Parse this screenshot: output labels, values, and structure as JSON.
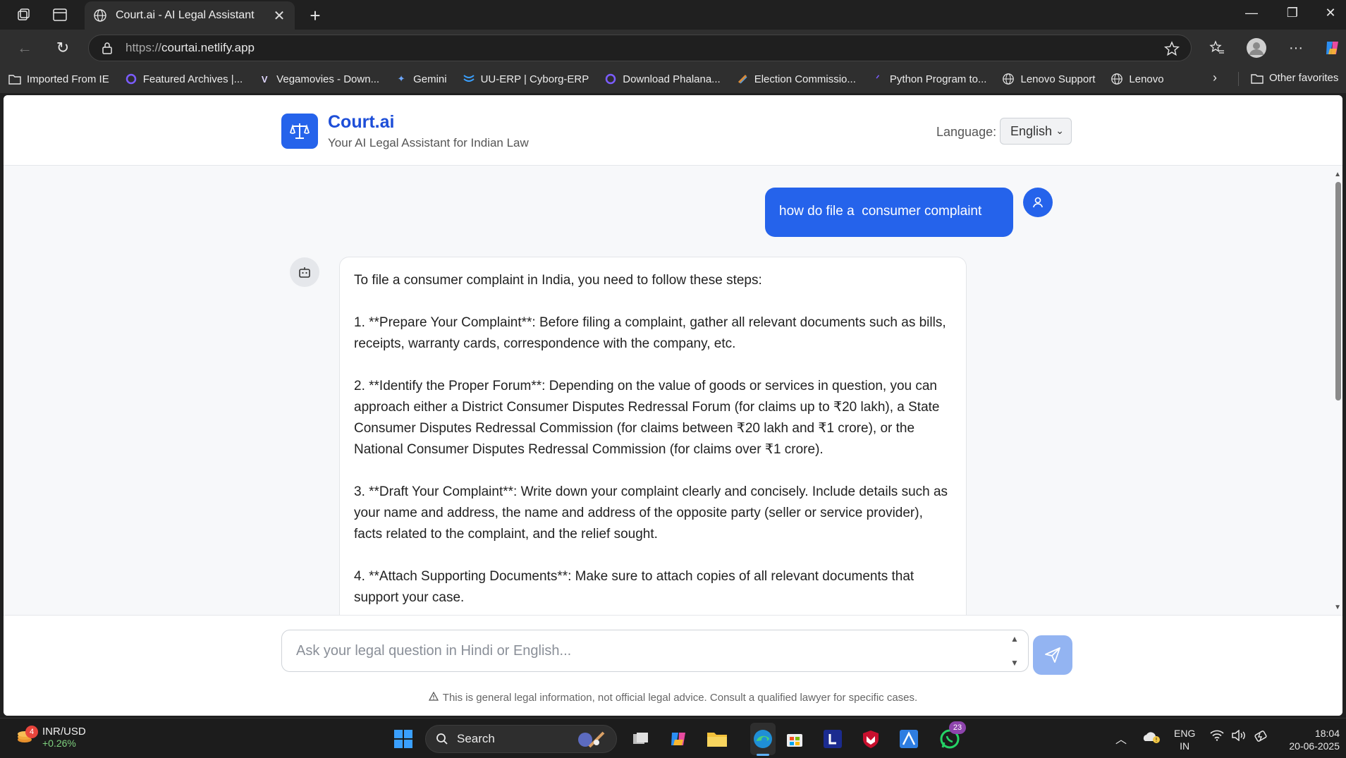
{
  "browser": {
    "tab_title": "Court.ai - AI Legal Assistant",
    "url_protocol": "https://",
    "url_host": "courtai.netlify.app",
    "favorites": [
      {
        "label": "Imported From IE",
        "icon": "folder-icon"
      },
      {
        "label": "Featured Archives |...",
        "icon": "archive-site-icon"
      },
      {
        "label": "Vegamovies - Down...",
        "icon": "v-logo-icon"
      },
      {
        "label": "Gemini",
        "icon": "gemini-sparkle-icon"
      },
      {
        "label": "UU-ERP | Cyborg-ERP",
        "icon": "erp-logo-icon"
      },
      {
        "label": "Download Phalana...",
        "icon": "site-icon"
      },
      {
        "label": "Election Commissio...",
        "icon": "election-icon"
      },
      {
        "label": "Python Program to...",
        "icon": "python-site-icon"
      },
      {
        "label": "Lenovo Support",
        "icon": "globe-icon"
      },
      {
        "label": "Lenovo",
        "icon": "globe-icon"
      }
    ],
    "other_favorites": "Other favorites"
  },
  "app": {
    "name": "Court.ai",
    "tagline": "Your AI Legal Assistant for Indian Law",
    "language_label": "Language:",
    "language_selected": "English",
    "accent_color": "#2563eb"
  },
  "chat": {
    "user_message": "how do file a  consumer complaint",
    "bot_paragraphs": [
      "To file a consumer complaint in India, you need to follow these steps:",
      "1. **Prepare Your Complaint**: Before filing a complaint, gather all relevant documents such as bills, receipts, warranty cards, correspondence with the company, etc.",
      "2. **Identify the Proper Forum**: Depending on the value of goods or services in question, you can approach either a District Consumer Disputes Redressal Forum (for claims up to ₹20 lakh), a State Consumer Disputes Redressal Commission (for claims between ₹20 lakh and ₹1 crore), or the National Consumer Disputes Redressal Commission (for claims over ₹1 crore).",
      "3. **Draft Your Complaint**: Write down your complaint clearly and concisely. Include details such as your name and address, the name and address of the opposite party (seller or service provider), facts related to the complaint, and the relief sought.",
      "4. **Attach Supporting Documents**: Make sure to attach copies of all relevant documents that support your case."
    ]
  },
  "input": {
    "placeholder": "Ask your legal question in Hindi or English..."
  },
  "disclaimer": "This is general legal information, not official legal advice. Consult a qualified lawyer for specific cases.",
  "taskbar": {
    "widget_badge": "4",
    "widget_title": "INR/USD",
    "widget_change": "+0.26%",
    "search_label": "Search",
    "whatsapp_badge": "23",
    "lang_line1": "ENG",
    "lang_line2": "IN",
    "time": "18:04",
    "date": "20-06-2025"
  }
}
